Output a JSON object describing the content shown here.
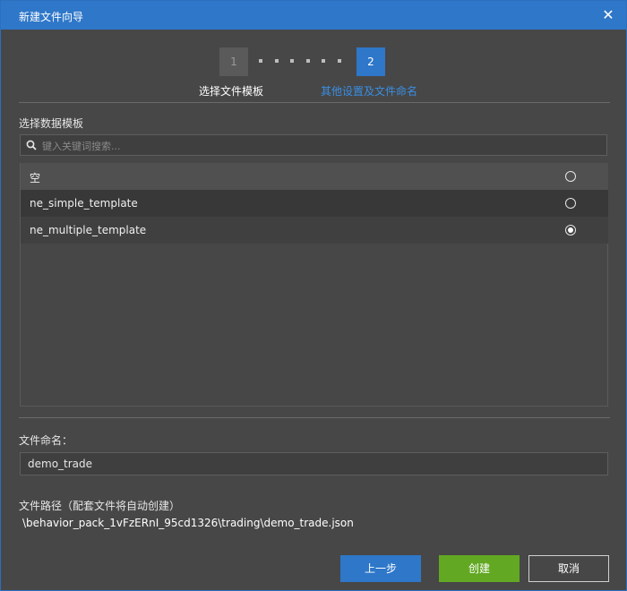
{
  "window": {
    "title": "新建文件向导"
  },
  "wizard": {
    "steps": [
      {
        "number": "1",
        "label": "选择文件模板"
      },
      {
        "number": "2",
        "label": "其他设置及文件命名"
      }
    ],
    "current_step": 2
  },
  "template_section": {
    "label": "选择数据模板",
    "search_placeholder": "键入关键词搜索..."
  },
  "templates": [
    {
      "label": "空",
      "selected": false
    },
    {
      "label": "ne_simple_template",
      "selected": false
    },
    {
      "label": "ne_multiple_template",
      "selected": true
    }
  ],
  "file_name": {
    "label": "文件命名：",
    "value": "demo_trade"
  },
  "file_path": {
    "label": "文件路径（配套文件将自动创建）",
    "value": "\\behavior_pack_1vFzERnI_95cd1326\\trading\\demo_trade.json"
  },
  "buttons": {
    "prev": "上一步",
    "create": "创建",
    "cancel": "取消"
  },
  "colors": {
    "accent": "#2e77c9",
    "create": "#62a823",
    "background": "#474747"
  }
}
